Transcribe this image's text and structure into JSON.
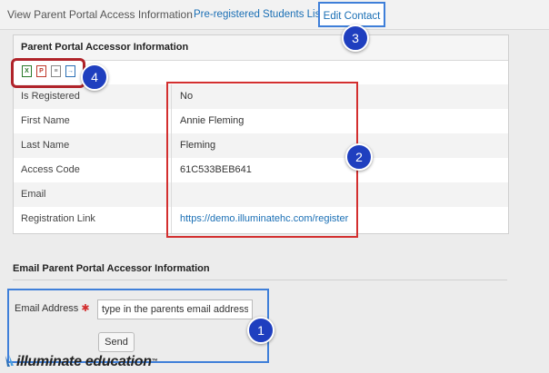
{
  "tabs": {
    "view": "View Parent Portal Access Information",
    "preregistered": "Pre-registered Students List",
    "edit": "Edit Contact"
  },
  "panel": {
    "title": "Parent Portal Accessor Information",
    "export_icons": [
      "excel-icon",
      "pdf-icon",
      "document-icon",
      "export-icon"
    ],
    "rows": [
      {
        "label": "Is Registered",
        "value": "No"
      },
      {
        "label": "First Name",
        "value": "Annie Fleming"
      },
      {
        "label": "Last Name",
        "value": "Fleming"
      },
      {
        "label": "Access Code",
        "value": "61C533BEB641"
      },
      {
        "label": "Email",
        "value": ""
      },
      {
        "label": "Registration Link",
        "value": "https://demo.illuminatehc.com/register"
      }
    ]
  },
  "email_section": {
    "title": "Email Parent Portal Accessor Information",
    "label": "Email Address",
    "required_marker": "✱",
    "input_value": "type in the parents email address!",
    "send_label": "Send"
  },
  "badges": [
    "1",
    "2",
    "3",
    "4"
  ],
  "logo": {
    "text": "illuminate education",
    "tm": "™"
  },
  "colors": {
    "link": "#1a6fb5",
    "badge": "#1f3fbf",
    "highlight_red": "#d32f2f",
    "highlight_blue": "#3f7fd9"
  }
}
